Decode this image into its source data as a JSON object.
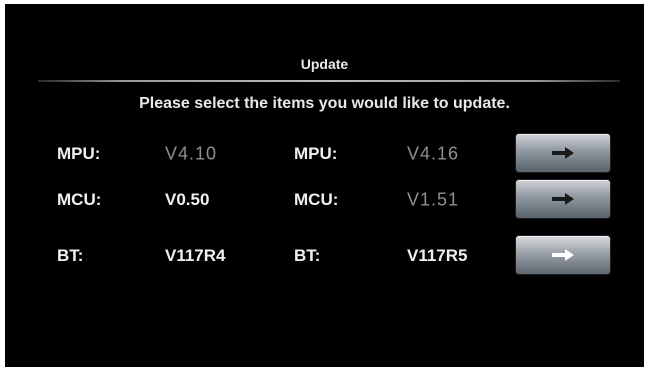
{
  "title": "Update",
  "subtitle": "Please select the items you would like to update.",
  "rows": [
    {
      "current_label": "MPU:",
      "current_value": "V4.10",
      "new_label": "MPU:",
      "new_value": "V4.16",
      "button_icon": "arrow-right-icon",
      "button_active": false
    },
    {
      "current_label": "MCU:",
      "current_value": "V0.50",
      "new_label": "MCU:",
      "new_value": "V1.51",
      "button_icon": "arrow-right-icon",
      "button_active": false
    },
    {
      "current_label": "BT:",
      "current_value": "V117R4",
      "new_label": "BT:",
      "new_value": "V117R5",
      "button_icon": "arrow-right-icon",
      "button_active": true
    }
  ],
  "colors": {
    "background": "#000000",
    "text": "#f0f0f0",
    "dim_text": "#8f8f8f",
    "arrow_inactive": "#1a1a1a",
    "arrow_active": "#ffffff"
  }
}
